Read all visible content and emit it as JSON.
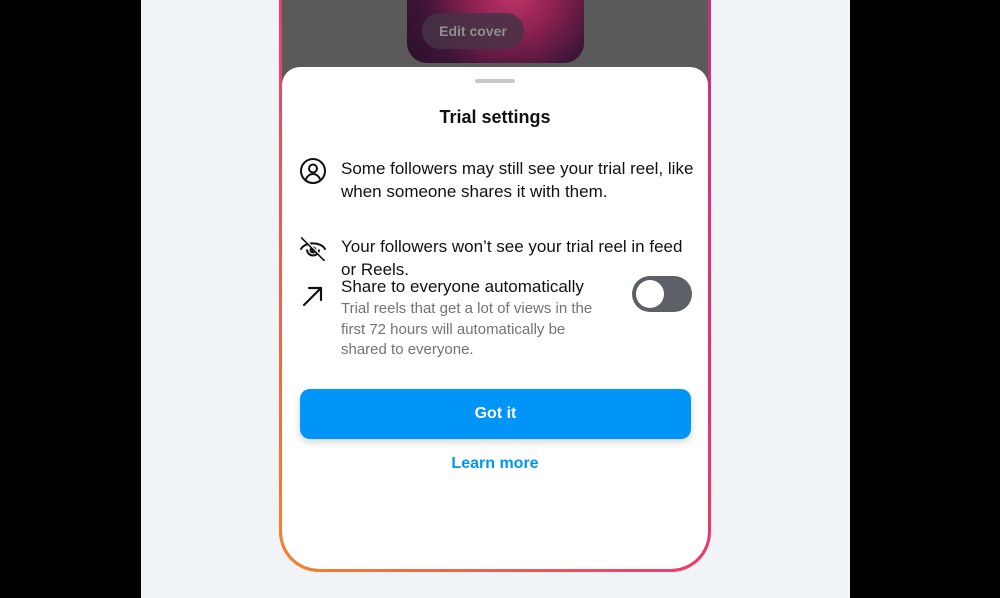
{
  "cover": {
    "edit_label": "Edit cover"
  },
  "sheet": {
    "title": "Trial settings",
    "items": [
      {
        "icon": "person-circle-icon",
        "text": "Some followers may still see your trial reel, like when someone shares it with them."
      },
      {
        "icon": "eye-off-icon",
        "text": "Your followers won’t see your trial reel in feed or Reels."
      }
    ],
    "auto_share": {
      "icon": "arrow-up-right-icon",
      "title": "Share to everyone automatically",
      "description": "Trial reels that get a lot of views in the first 72 hours will automatically be shared to everyone.",
      "enabled": false
    },
    "primary_button": "Got it",
    "secondary_link": "Learn more"
  },
  "colors": {
    "accent": "#0095f6",
    "toggle_off": "#5e6067",
    "frame_start": "#f58529",
    "frame_end": "#e1306c"
  }
}
